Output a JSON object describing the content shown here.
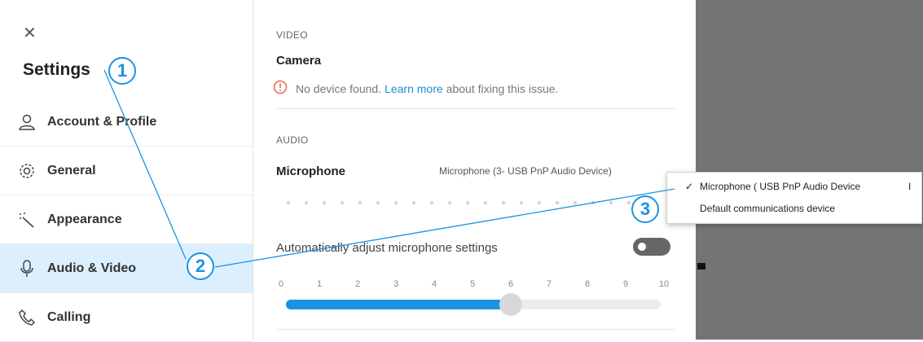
{
  "sidebar": {
    "close_icon": "close-icon",
    "title": "Settings",
    "items": [
      {
        "label": "Account & Profile",
        "icon": "person-icon",
        "active": false
      },
      {
        "label": "General",
        "icon": "gear-icon",
        "active": false
      },
      {
        "label": "Appearance",
        "icon": "magic-wand-icon",
        "active": false
      },
      {
        "label": "Audio & Video",
        "icon": "microphone-icon",
        "active": true
      },
      {
        "label": "Calling",
        "icon": "phone-icon",
        "active": false
      }
    ]
  },
  "video": {
    "section_label": "VIDEO",
    "camera_title": "Camera",
    "warning_text_before": "No device found.",
    "warning_link": "Learn more",
    "warning_text_after": "about fixing this issue."
  },
  "audio": {
    "section_label": "AUDIO",
    "microphone_title": "Microphone",
    "microphone_value": "Microphone (3- USB PnP Audio Device)",
    "auto_adjust_label": "Automatically adjust microphone settings",
    "auto_adjust_on": false,
    "volume_ticks": [
      "0",
      "1",
      "2",
      "3",
      "4",
      "5",
      "6",
      "7",
      "8",
      "9",
      "10"
    ],
    "volume_level": 6
  },
  "dropdown": {
    "options": [
      {
        "label": "Microphone ( USB PnP Audio Device",
        "selected": true
      },
      {
        "label": "Default communications device",
        "selected": false
      }
    ]
  },
  "annotations": {
    "badges": [
      "1",
      "2",
      "3"
    ]
  },
  "colors": {
    "accent": "#1a94e0",
    "active_bg": "#dcefff",
    "warning": "#e06a4a",
    "dark_panel": "#747474"
  }
}
